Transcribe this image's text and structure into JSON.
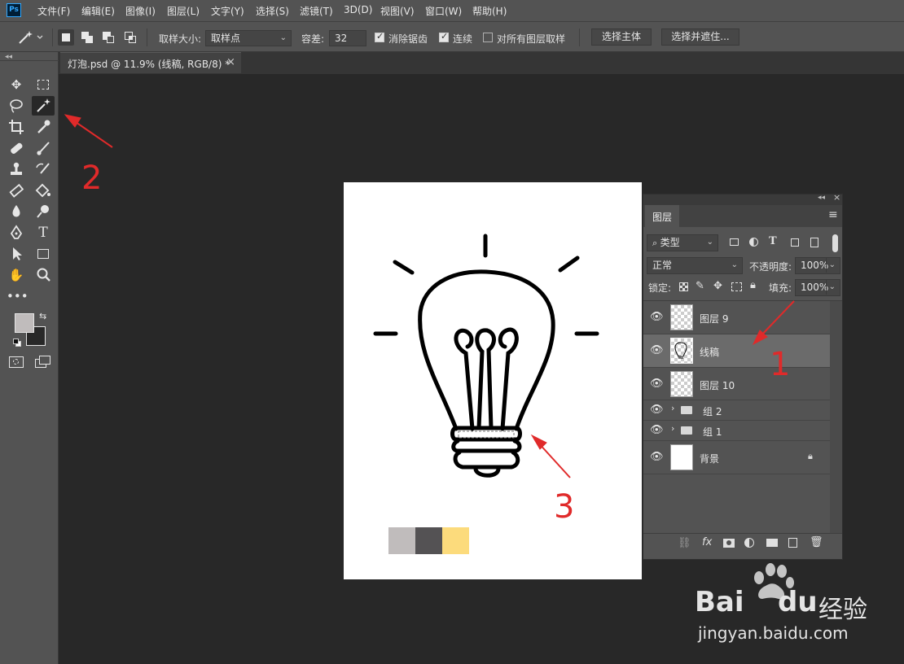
{
  "app": {
    "logo": "Ps"
  },
  "menu": [
    "文件(F)",
    "编辑(E)",
    "图像(I)",
    "图层(L)",
    "文字(Y)",
    "选择(S)",
    "滤镜(T)",
    "3D(D)",
    "视图(V)",
    "窗口(W)",
    "帮助(H)"
  ],
  "options": {
    "sample_size_label": "取样大小:",
    "sample_size_value": "取样点",
    "tolerance_label": "容差:",
    "tolerance_value": "32",
    "antialias_label": "消除锯齿",
    "antialias_checked": true,
    "contiguous_label": "连续",
    "contiguous_checked": true,
    "sample_all_layers_label": "对所有图层取样",
    "sample_all_layers_checked": false,
    "select_subject_label": "选择主体",
    "select_and_mask_label": "选择并遮住..."
  },
  "document": {
    "tab_title": "灯泡.psd @ 11.9% (线稿, RGB/8) *",
    "close_glyph": "×"
  },
  "swatches": [
    "#c0bcbc",
    "#545254",
    "#fcdb7c"
  ],
  "layers_panel": {
    "title": "图层",
    "filter_kind": "类型",
    "blend_mode": "正常",
    "opacity_label": "不透明度:",
    "opacity_value": "100%",
    "lock_label": "锁定:",
    "fill_label": "填充:",
    "fill_value": "100%",
    "layers": [
      {
        "name": "图层 9",
        "type": "layer",
        "selected": false
      },
      {
        "name": "线稿",
        "type": "layer",
        "selected": true
      },
      {
        "name": "图层 10",
        "type": "layer",
        "selected": false
      },
      {
        "name": "组 2",
        "type": "group",
        "selected": false
      },
      {
        "name": "组 1",
        "type": "group",
        "selected": false
      },
      {
        "name": "背景",
        "type": "background",
        "selected": false,
        "locked": true
      }
    ]
  },
  "annotations": {
    "n1": "1",
    "n2": "2",
    "n3": "3"
  },
  "watermark": {
    "brand": "Bai",
    "brand2": "du",
    "jingyan": "经验",
    "url": "jingyan.baidu.com"
  }
}
